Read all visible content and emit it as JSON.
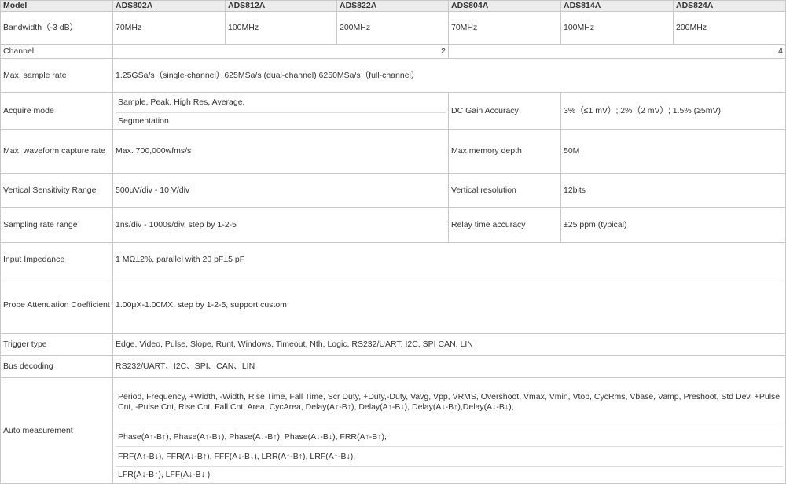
{
  "header": {
    "model_label": "Model",
    "models": [
      "ADS802A",
      "ADS812A",
      "ADS822A",
      "ADS804A",
      "ADS814A",
      "ADS824A"
    ]
  },
  "rows": {
    "bandwidth": {
      "label": "Bandwidth（-3 dB）",
      "values": [
        "70MHz",
        "100MHz",
        "200MHz",
        "70MHz",
        "100MHz",
        "200MHz"
      ]
    },
    "channel": {
      "label": "Channel",
      "left": "2",
      "right": "4"
    },
    "sample_rate": {
      "label": "Max. sample rate",
      "value": "1.25GSa/s（single-channel）625MSa/s (dual-channel) 6250MSa/s（full-channel）"
    },
    "acquire_mode": {
      "label": "Acquire mode",
      "lines": [
        "Sample, Peak, High Res, Average,",
        "Segmentation"
      ],
      "right_label": "DC Gain Accuracy",
      "right_value": "3%（≤1 mV）; 2%（2 mV）; 1.5% (≥5mV)"
    },
    "capture_rate": {
      "label": "Max. waveform capture rate",
      "value": "Max. 700,000wfms/s",
      "right_label": "Max memory depth",
      "right_value": "50M"
    },
    "vertical_sensitivity": {
      "label": "Vertical Sensitivity Range",
      "value": "500μV/div - 10 V/div",
      "right_label": "Vertical resolution",
      "right_value": "12bits"
    },
    "sampling_range": {
      "label": "Sampling rate range",
      "value": "1ns/div - 1000s/div, step by 1-2-5",
      "right_label": "Relay time accuracy",
      "right_value": "±25 ppm (typical)"
    },
    "input_impedance": {
      "label": "Input Impedance",
      "value": "1 MΩ±2%,  parallel with 20 pF±5 pF"
    },
    "probe_attenuation": {
      "label": "Probe Attenuation Coefficient",
      "value": "1.00μX-1.00MX, step by 1-2-5, support custom"
    },
    "trigger_type": {
      "label": "Trigger type",
      "value": "Edge, Video, Pulse, Slope, Runt, Windows, Timeout, Nth, Logic, RS232/UART, I2C, SPI CAN, LIN"
    },
    "bus_decoding": {
      "label": "Bus decoding",
      "value": "RS232/UART、I2C、SPI、CAN、LIN"
    },
    "auto_measurement": {
      "label": "Auto measurement",
      "lines": [
        "Period, Frequency, +Width, -Width, Rise Time, Fall Time, Scr Duty, +Duty,-Duty, Vavg, Vpp, VRMS, Overshoot, Vmax, Vmin, Vtop, CycRms, Vbase, Vamp, Preshoot, Std Dev, +Pulse Cnt, -Pulse Cnt, Rise Cnt, Fall Cnt, Area, CycArea, Delay(A↑-B↑), Delay(A↑-B↓), Delay(A↓-B↑),Delay(A↓-B↓),",
        "Phase(A↑-B↑), Phase(A↑-B↓), Phase(A↓-B↑), Phase(A↓-B↓), FRR(A↑-B↑),",
        "FRF(A↑-B↓), FFR(A↓-B↑), FFF(A↓-B↓), LRR(A↑-B↑), LRF(A↑-B↓),",
        "LFR(A↓-B↑), LFF(A↓-B↓ )"
      ]
    }
  }
}
